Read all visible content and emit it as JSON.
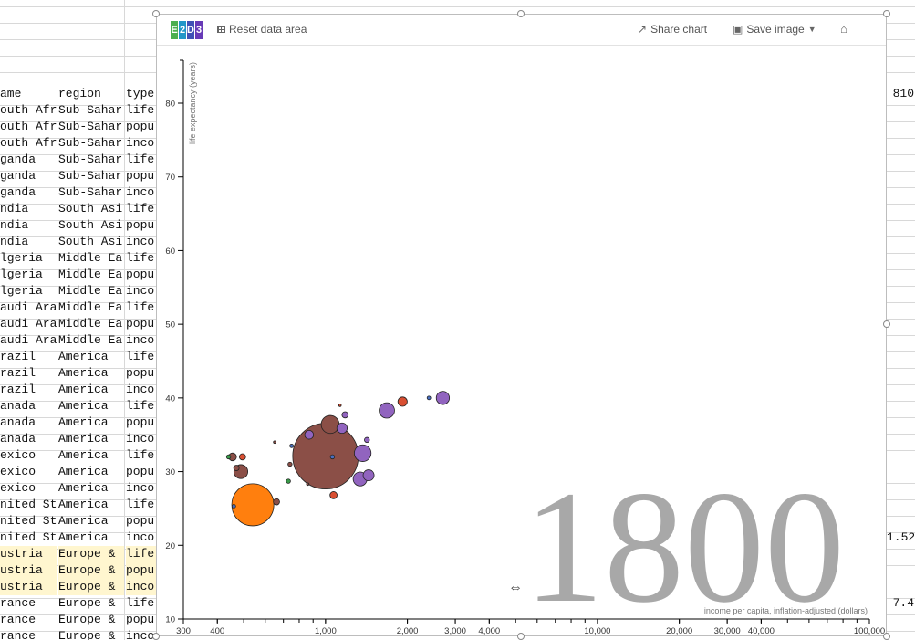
{
  "spreadsheet": {
    "header_row": [
      "ame",
      "region",
      "type"
    ],
    "header_right": "810",
    "rows": [
      [
        "outh Afr",
        "Sub-Sahar",
        "life"
      ],
      [
        "outh Afr",
        "Sub-Sahar",
        "popu"
      ],
      [
        "outh Afr",
        "Sub-Sahar",
        "inco"
      ],
      [
        "ganda",
        "Sub-Sahar",
        "life"
      ],
      [
        "ganda",
        "Sub-Sahar",
        "popu"
      ],
      [
        "ganda",
        "Sub-Sahar",
        "inco"
      ],
      [
        "ndia",
        "South Asi",
        "life"
      ],
      [
        "ndia",
        "South Asi",
        "popu"
      ],
      [
        "ndia",
        "South Asi",
        "inco"
      ],
      [
        "lgeria",
        "Middle Ea",
        "life"
      ],
      [
        "lgeria",
        "Middle Ea",
        "popu"
      ],
      [
        "lgeria",
        "Middle Ea",
        "inco"
      ],
      [
        "audi Ara",
        "Middle Ea",
        "life"
      ],
      [
        "audi Ara",
        "Middle Ea",
        "popu"
      ],
      [
        "audi Ara",
        "Middle Ea",
        "inco"
      ],
      [
        "razil",
        "America",
        "life"
      ],
      [
        "razil",
        "America",
        "popu"
      ],
      [
        "razil",
        "America",
        "inco"
      ],
      [
        "anada",
        "America",
        "life"
      ],
      [
        "anada",
        "America",
        "popu"
      ],
      [
        "anada",
        "America",
        "inco"
      ],
      [
        "exico",
        "America",
        "life"
      ],
      [
        "exico",
        "America",
        "popu"
      ],
      [
        "exico",
        "America",
        "inco"
      ],
      [
        "nited St",
        "America",
        "life"
      ],
      [
        "nited St",
        "America",
        "popu"
      ],
      [
        "nited St",
        "America",
        "inco"
      ],
      [
        "ustria",
        "Europe &",
        "life"
      ],
      [
        "ustria",
        "Europe &",
        "popu"
      ],
      [
        "ustria",
        "Europe &",
        "inco"
      ],
      [
        "rance",
        "Europe &",
        "life"
      ],
      [
        "rance",
        "Europe &",
        "popu"
      ],
      [
        "rance",
        "Europe &",
        "inco"
      ]
    ],
    "right_values": {
      "row27": "1.52",
      "row31": "7.4"
    }
  },
  "toolbar": {
    "logo_letters": [
      "E",
      "2",
      "D",
      "3"
    ],
    "reset_label": "Reset data area",
    "share_label": "Share chart",
    "save_label": "Save image"
  },
  "colors": {
    "sub_saharan_africa": "#8b4f47",
    "south_asia": "#ff7f0e",
    "middle_east": "#d94f32",
    "america": "#9164bf",
    "europe": "#3a9c4a",
    "other": "#4a6fc0",
    "year_text": "#a8a8a8",
    "axis": "#000000"
  },
  "chart_data": {
    "type": "scatter",
    "year_label": "1800",
    "xlabel": "income per capita, inflation-adjusted (dollars)",
    "ylabel": "life expectancy (years)",
    "x_scale": "log",
    "xlim": [
      300,
      100000
    ],
    "ylim": [
      10,
      85
    ],
    "x_ticks": [
      300,
      400,
      1000,
      2000,
      3000,
      4000,
      10000,
      20000,
      30000,
      40000,
      100000
    ],
    "x_tick_labels": [
      "300",
      "400",
      "1,000",
      "2,000",
      "3,000",
      "4,000",
      "10,000",
      "20,000",
      "30,000",
      "40,000",
      "100,000"
    ],
    "y_ticks": [
      10,
      20,
      30,
      40,
      50,
      60,
      70,
      80
    ],
    "y_tick_labels": [
      "10",
      "20",
      "30",
      "40",
      "50",
      "60",
      "70",
      "80"
    ],
    "grid": false,
    "points": [
      {
        "x": 1000,
        "y": 32.1,
        "size": 1000,
        "group": "sub_saharan_africa"
      },
      {
        "x": 540,
        "y": 25.5,
        "size": 410,
        "group": "south_asia"
      },
      {
        "x": 1040,
        "y": 36.4,
        "size": 75,
        "group": "sub_saharan_africa"
      },
      {
        "x": 1370,
        "y": 32.5,
        "size": 65,
        "group": "america"
      },
      {
        "x": 1680,
        "y": 38.3,
        "size": 55,
        "group": "america"
      },
      {
        "x": 2700,
        "y": 40.0,
        "size": 40,
        "group": "america"
      },
      {
        "x": 1340,
        "y": 29.0,
        "size": 45,
        "group": "america"
      },
      {
        "x": 488,
        "y": 30.0,
        "size": 45,
        "group": "sub_saharan_africa"
      },
      {
        "x": 1440,
        "y": 29.5,
        "size": 28,
        "group": "america"
      },
      {
        "x": 1150,
        "y": 35.9,
        "size": 25,
        "group": "america"
      },
      {
        "x": 870,
        "y": 35.0,
        "size": 18,
        "group": "america"
      },
      {
        "x": 1920,
        "y": 39.5,
        "size": 20,
        "group": "middle_east"
      },
      {
        "x": 455,
        "y": 32.0,
        "size": 14,
        "group": "sub_saharan_africa"
      },
      {
        "x": 1070,
        "y": 26.8,
        "size": 12,
        "group": "middle_east"
      },
      {
        "x": 495,
        "y": 32.0,
        "size": 9,
        "group": "middle_east"
      },
      {
        "x": 660,
        "y": 25.9,
        "size": 9,
        "group": "sub_saharan_africa"
      },
      {
        "x": 1180,
        "y": 37.7,
        "size": 9,
        "group": "america"
      },
      {
        "x": 1420,
        "y": 34.3,
        "size": 6,
        "group": "america"
      },
      {
        "x": 470,
        "y": 30.5,
        "size": 7,
        "group": "sub_saharan_africa"
      },
      {
        "x": 730,
        "y": 28.7,
        "size": 4,
        "group": "europe"
      },
      {
        "x": 740,
        "y": 31.0,
        "size": 4,
        "group": "sub_saharan_africa"
      },
      {
        "x": 440,
        "y": 32.0,
        "size": 4,
        "group": "europe"
      },
      {
        "x": 1060,
        "y": 32.0,
        "size": 4,
        "group": "other"
      },
      {
        "x": 750,
        "y": 33.5,
        "size": 3,
        "group": "other"
      },
      {
        "x": 2400,
        "y": 40.0,
        "size": 3,
        "group": "other"
      },
      {
        "x": 460,
        "y": 25.3,
        "size": 3,
        "group": "other"
      },
      {
        "x": 1130,
        "y": 39.0,
        "size": 1.5,
        "group": "middle_east"
      },
      {
        "x": 860,
        "y": 28.3,
        "size": 1.5,
        "group": "sub_saharan_africa"
      },
      {
        "x": 650,
        "y": 34.0,
        "size": 0.6,
        "group": "sub_saharan_africa"
      }
    ]
  }
}
